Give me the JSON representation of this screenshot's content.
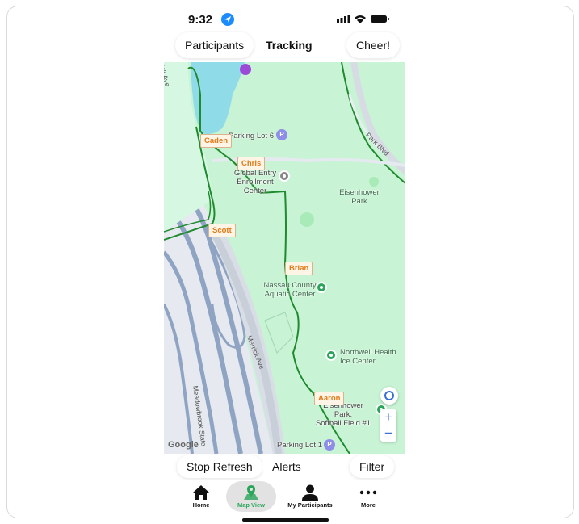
{
  "status": {
    "time": "9:32"
  },
  "topbar": {
    "participants": "Participants",
    "tracking": "Tracking",
    "cheer": "Cheer!"
  },
  "map": {
    "participants": [
      {
        "name": "Caden"
      },
      {
        "name": "Chris"
      },
      {
        "name": "Scott"
      },
      {
        "name": "Brian"
      },
      {
        "name": "Aaron"
      }
    ],
    "places": {
      "parking6": "Parking Lot 6",
      "global1": "Global Entry",
      "global2": "Enrollment Center",
      "eisen1": "Eisenhower",
      "eisen2": "Park",
      "aquatic1": "Nassau County",
      "aquatic2": "Aquatic Center",
      "northwell1": "Northwell Health",
      "northwell2": "Ice Center",
      "softball1": "Eisenhower Park:",
      "softball2": "Softball Field #1",
      "parking1": "Parking Lot 1"
    },
    "roads": {
      "merrick_top": "rick Ave",
      "merrick": "Merrick Ave",
      "park_blvd": "Park Blvd",
      "meadowbrook": "Meadowbrook State"
    },
    "parking_badge": "P",
    "google": "Google"
  },
  "bottombar": {
    "stop_refresh": "Stop Refresh",
    "alerts": "Alerts",
    "filter": "Filter"
  },
  "tabs": [
    {
      "label": "Home",
      "icon": "home-icon"
    },
    {
      "label": "Map View",
      "icon": "map-pin-icon"
    },
    {
      "label": "My Participants",
      "icon": "person-icon"
    },
    {
      "label": "More",
      "icon": "more-dots-icon"
    }
  ],
  "colors": {
    "accent": "#2aa55a",
    "route": "#1f8a2e",
    "tag_text": "#e07b1a"
  }
}
